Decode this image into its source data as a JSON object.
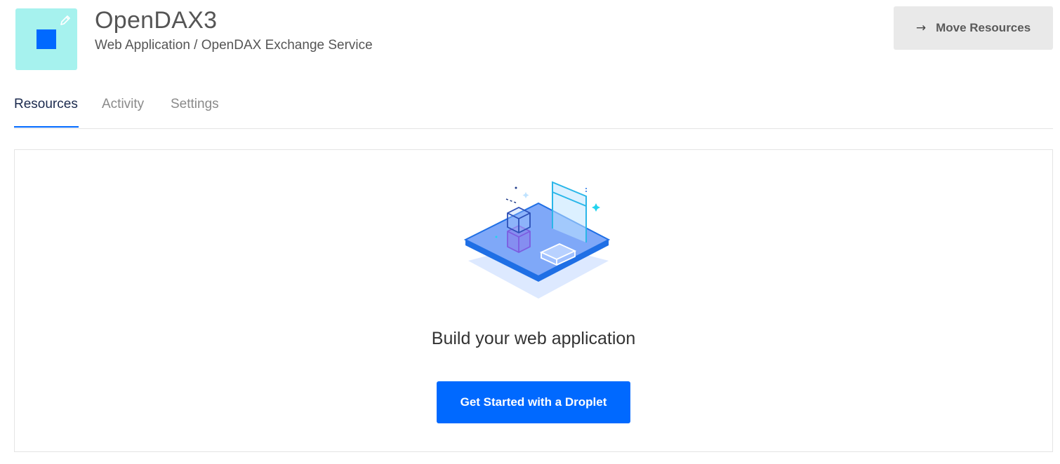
{
  "project": {
    "name": "OpenDAX3",
    "subtitle": "Web Application / OpenDAX Exchange Service",
    "icon": "pencil-icon",
    "icon_bg_color": "#a6f2ee",
    "icon_square_color": "#0069ff"
  },
  "header": {
    "move_button_arrow": "→",
    "move_button_label": "Move Resources"
  },
  "tabs": [
    {
      "label": "Resources",
      "active": true
    },
    {
      "label": "Activity",
      "active": false
    },
    {
      "label": "Settings",
      "active": false
    }
  ],
  "empty_state": {
    "illustration": "web-application-illustration",
    "title": "Build your web application",
    "button_label": "Get Started with a Droplet"
  },
  "colors": {
    "accent": "#0069ff",
    "tab_active": "#1b2a4e",
    "tab_inactive": "#8a8a8a"
  }
}
